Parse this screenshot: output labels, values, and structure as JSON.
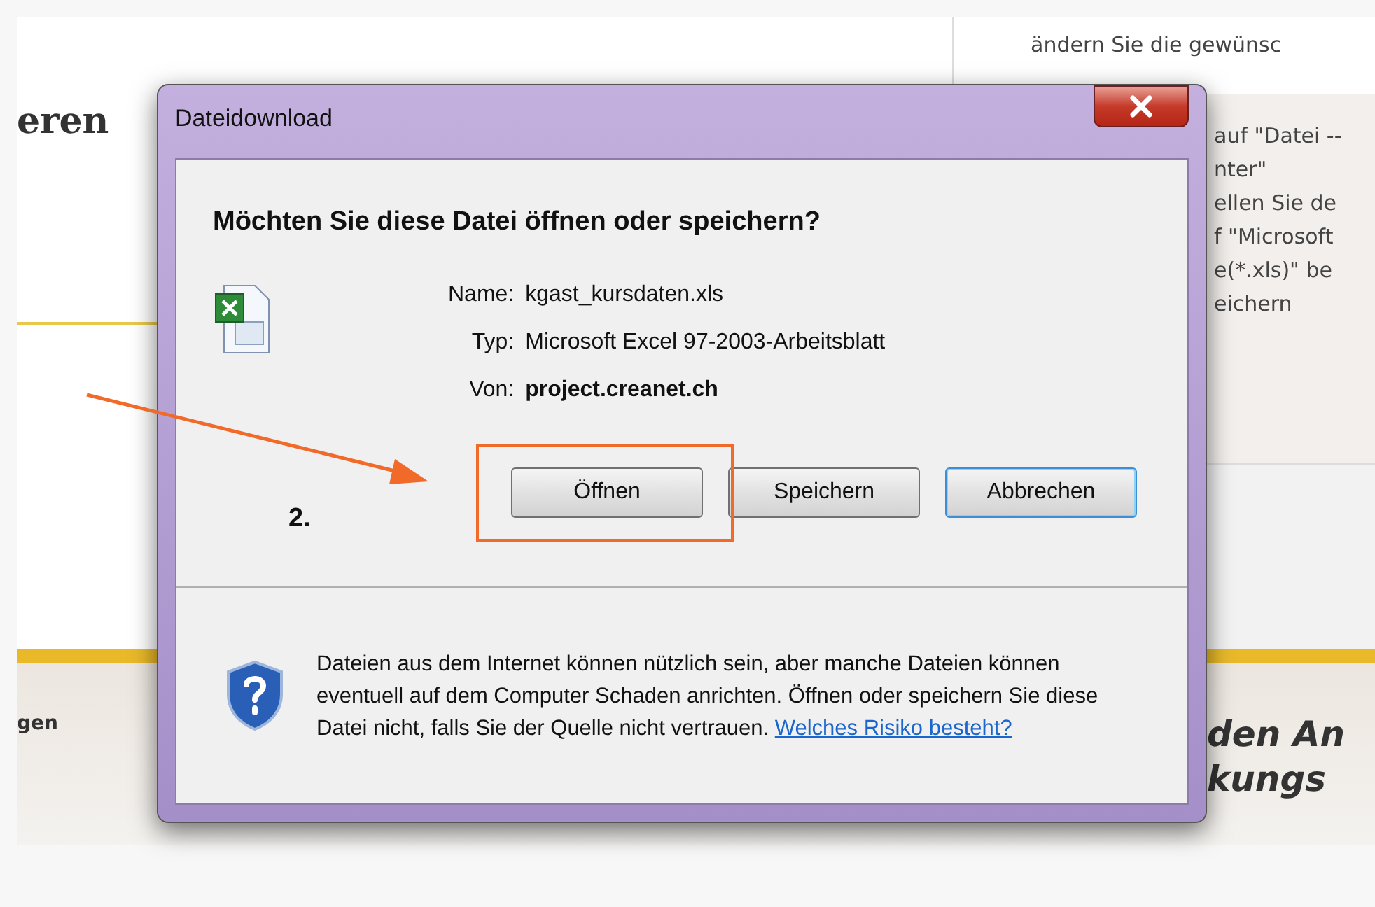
{
  "page": {
    "heading": "eren",
    "panel_top_line": "ändern Sie die gewünsc",
    "panel_lines": [
      "auf \"Datei --",
      "nter\"",
      "ellen Sie de",
      "f \"Microsoft",
      "e(*.xls)\" be",
      "eichern"
    ],
    "footer_left": "gen",
    "footer_right_lines": [
      "den An",
      "kungs"
    ]
  },
  "dialog": {
    "title": "Dateidownload",
    "question": "Möchten Sie diese Datei öffnen oder speichern?",
    "fields": [
      {
        "label": "Name:",
        "value": "kgast_kursdaten.xls",
        "bold": false
      },
      {
        "label": "Typ:",
        "value": "Microsoft Excel 97-2003-Arbeitsblatt",
        "bold": false
      },
      {
        "label": "Von:",
        "value": "project.creanet.ch",
        "bold": true
      }
    ],
    "buttons": [
      {
        "label": "Öffnen",
        "default": false
      },
      {
        "label": "Speichern",
        "default": false
      },
      {
        "label": "Abbrechen",
        "default": true
      }
    ],
    "warning": {
      "text": "Dateien aus dem Internet können nützlich sein, aber manche Dateien können eventuell auf dem Computer Schaden anrichten. Öffnen oder speichern Sie diese Datei nicht, falls Sie der Quelle nicht vertrauen.",
      "link": "Welches Risiko besteht?"
    }
  },
  "annotation": {
    "step": "2."
  }
}
